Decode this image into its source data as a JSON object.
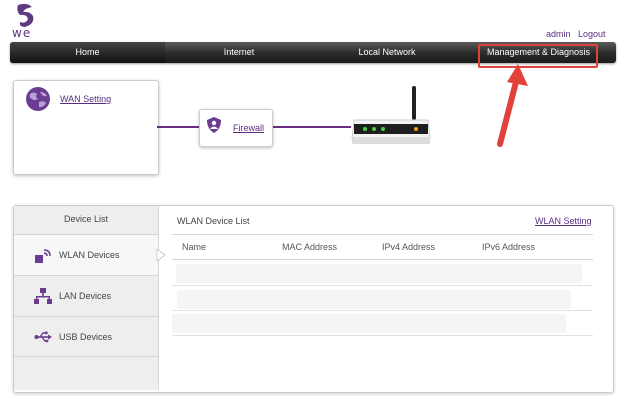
{
  "header": {
    "brand": "we",
    "admin_label": "admin",
    "logout_label": "Logout"
  },
  "nav": {
    "items": [
      "Home",
      "Internet",
      "Local Network",
      "Management & Diagnosis"
    ],
    "active": "Home"
  },
  "topology": {
    "wan_label": "WAN Setting",
    "firewall_label": "Firewall"
  },
  "devices": {
    "sidebar_title": "Device List",
    "menu": [
      "WLAN Devices",
      "LAN Devices",
      "USB Devices"
    ],
    "list_title": "WLAN Device List",
    "settings_link": "WLAN Setting",
    "columns": [
      "Name",
      "MAC Address",
      "IPv4 Address",
      "IPv6 Address"
    ]
  },
  "colors": {
    "brand_purple": "#5a2d82",
    "highlight_red": "#e0413a"
  }
}
